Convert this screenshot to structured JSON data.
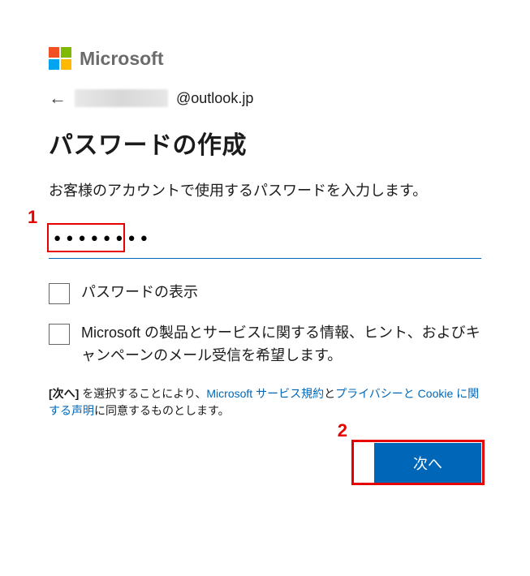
{
  "brand": {
    "name": "Microsoft"
  },
  "identity": {
    "domain_suffix": "@outlook.jp"
  },
  "title": "パスワードの作成",
  "instruction": "お客様のアカウントで使用するパスワードを入力します。",
  "password": {
    "value": "••••••••"
  },
  "checkboxes": {
    "show_password_label": "パスワードの表示",
    "marketing_label": "Microsoft の製品とサービスに関する情報、ヒント、およびキャンペーンのメール受信を希望します。"
  },
  "legal": {
    "prefix_bold": "[次へ]",
    "text1": " を選択することにより、",
    "link_tos": "Microsoft サービス規約",
    "text2": "と",
    "link_privacy": "プライバシーと Cookie に関する声明",
    "text3": "に同意するものとします。"
  },
  "buttons": {
    "next_label": "次へ"
  },
  "annotations": {
    "step1": "1",
    "step2": "2"
  }
}
